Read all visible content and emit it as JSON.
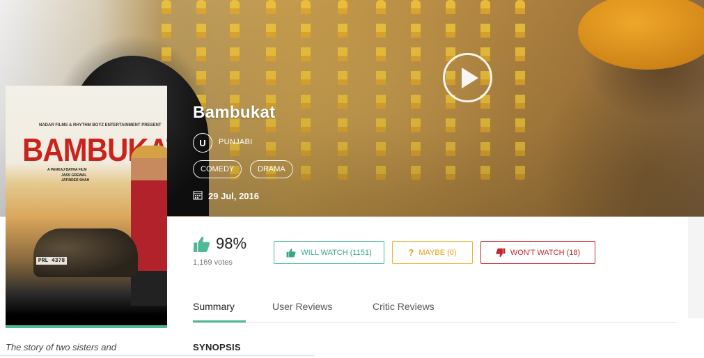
{
  "movie": {
    "title": "Bambukat",
    "certificate": "U",
    "language": "PUNJABI",
    "genres": [
      "COMEDY",
      "DRAMA"
    ],
    "release_date": "29 Jul, 2016"
  },
  "poster": {
    "topline": "NADAR FILMS & RHYTHM BOYZ ENTERTAINMENT PRESENT",
    "title": "BAMBUKAT",
    "director_line": "A PANKAJ BATRA FILM",
    "starring_line": "JASS GREWAL",
    "music_line": "JATINDER SHAH",
    "plate": "PRL 4378"
  },
  "rating": {
    "percent": "98%",
    "votes": "1,169 votes"
  },
  "actions": {
    "will_watch": "WILL WATCH (1151)",
    "maybe": "MAYBE (0)",
    "wont_watch": "WON'T WATCH (18)"
  },
  "tabs": [
    {
      "label": "Summary",
      "active": true
    },
    {
      "label": "User Reviews",
      "active": false
    },
    {
      "label": "Critic Reviews",
      "active": false
    }
  ],
  "synopsis": {
    "heading": "SYNOPSIS",
    "story_start": "The story of two sisters and"
  },
  "icons": {
    "play": "play-icon",
    "calendar": "calendar-icon",
    "thumbs_up": "thumbs-up-icon",
    "question": "question-icon",
    "thumbs_down": "thumbs-down-icon"
  },
  "colors": {
    "accent_green": "#4fb996",
    "maybe_orange": "#f0b030",
    "wont_red": "#c8242e"
  }
}
